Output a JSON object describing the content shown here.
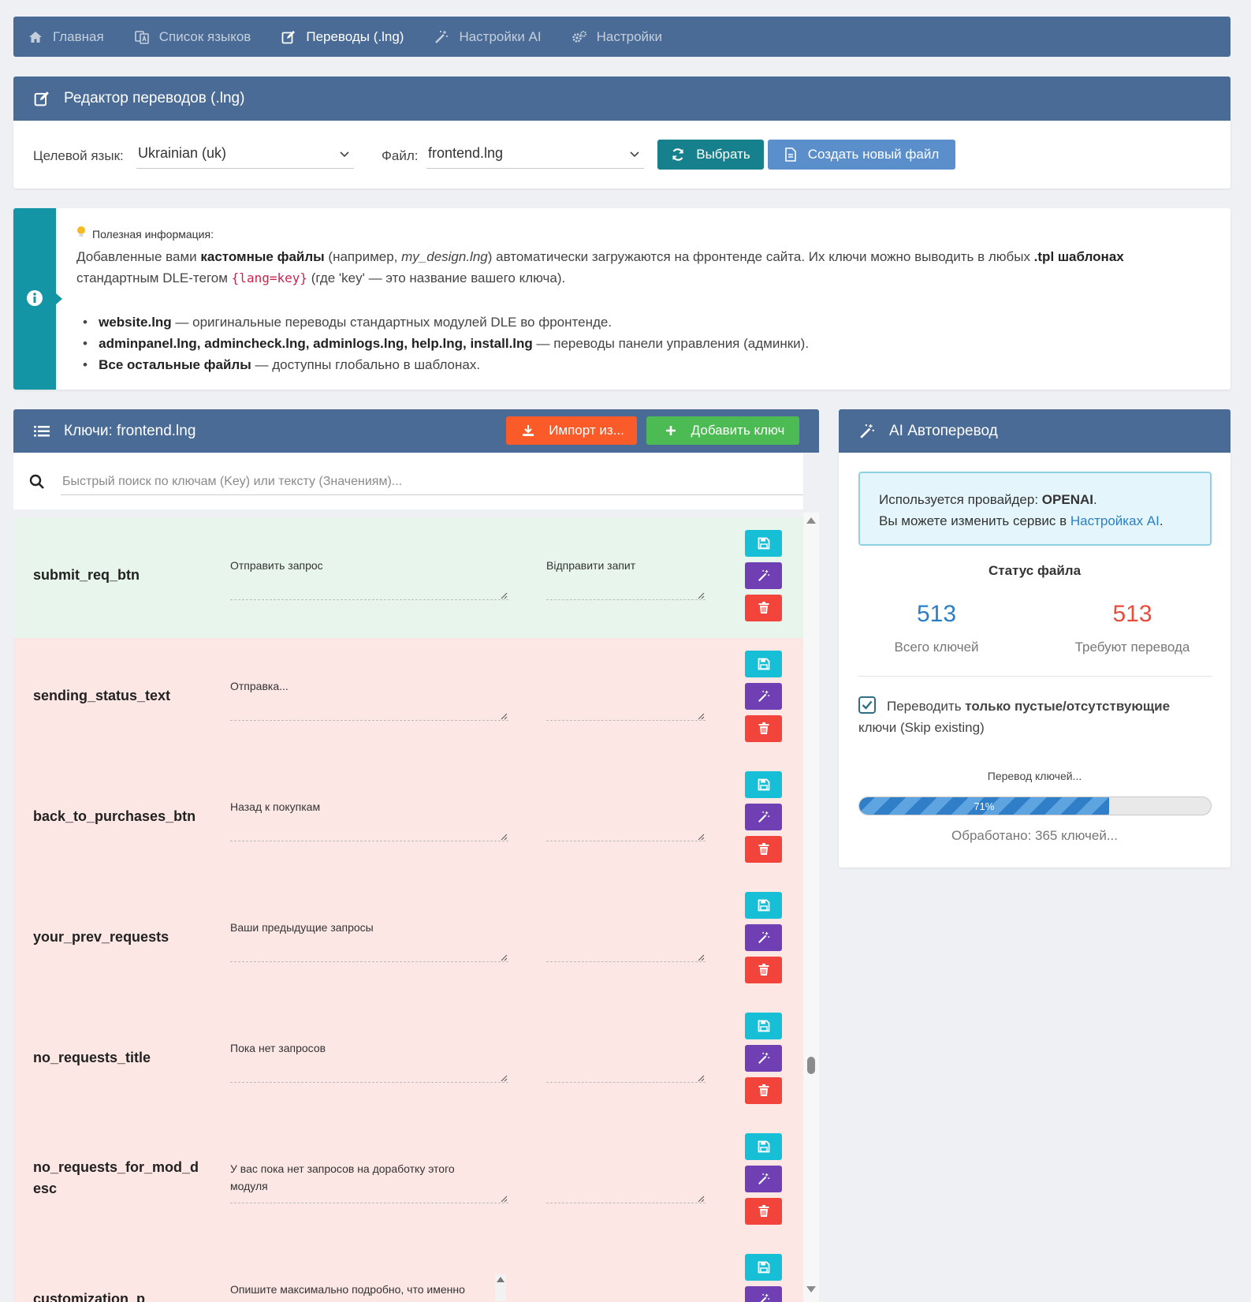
{
  "nav": {
    "items": [
      {
        "label": "Главная",
        "icon": "home-icon"
      },
      {
        "label": "Список языков",
        "icon": "language-icon"
      },
      {
        "label": "Переводы (.lng)",
        "icon": "edit-icon",
        "active": true
      },
      {
        "label": "Настройки AI",
        "icon": "magic-wand-icon"
      },
      {
        "label": "Настройки",
        "icon": "gears-icon"
      }
    ]
  },
  "editor": {
    "title": "Редактор переводов (.lng)",
    "target_lang_label": "Целевой язык:",
    "target_lang_value": "Ukrainian (uk)",
    "file_label": "Файл:",
    "file_value": "frontend.lng",
    "select_button": "Выбрать",
    "new_file_button": "Создать новый файл"
  },
  "info": {
    "title": "Полезная информация:",
    "p_part1": "Добавленные вами ",
    "p_bold1": "кастомные файлы",
    "p_part2": " (например, ",
    "p_italic": "my_design.lng",
    "p_part3": ") автоматически загружаются на фронтенде сайта. Их ключи можно выводить в любых ",
    "p_bold2": ".tpl шаблонах",
    "p_part4": "стандартным DLE-тегом ",
    "p_code": "{lang=key}",
    "p_part5": " (где 'key' — это название вашего ключа).",
    "bullets": [
      {
        "bold": "website.lng",
        "text": " — оригинальные переводы стандартных модулей DLE во фронтенде."
      },
      {
        "bold": "adminpanel.lng, admincheck.lng, adminlogs.lng, help.lng, install.lng",
        "text": " — переводы панели управления (админки)."
      },
      {
        "bold": "Все остальные файлы",
        "text": " — доступны глобально в шаблонах."
      }
    ]
  },
  "keys": {
    "title": "Ключи: frontend.lng",
    "import_button": "Импорт из...",
    "add_button": "Добавить ключ",
    "search_placeholder": "Быстрый поиск по ключам (Key) или тексту (Значениям)...",
    "rows": [
      {
        "key": "submit_req_btn",
        "original": "Отправить запрос",
        "translation": "Відправити запит",
        "status": "translated"
      },
      {
        "key": "sending_status_text",
        "original": "Отправка...",
        "translation": "",
        "status": "missing"
      },
      {
        "key": "back_to_purchases_btn",
        "original": "Назад к покупкам",
        "translation": "",
        "status": "missing"
      },
      {
        "key": "your_prev_requests",
        "original": "Ваши предыдущие запросы",
        "translation": "",
        "status": "missing"
      },
      {
        "key": "no_requests_title",
        "original": "Пока нет запросов",
        "translation": "",
        "status": "missing"
      },
      {
        "key": "no_requests_for_mod_desc",
        "key_line1": "no_requests_for_mod_d",
        "key_line2": "esc",
        "original_line1": "У вас пока нет запросов на доработку этого",
        "original_line2": "модуля",
        "translation": "",
        "status": "missing"
      },
      {
        "key": "customization_p",
        "original": "Опишите максимально подробно, что именно",
        "translation": "",
        "status": "missing"
      }
    ]
  },
  "ai": {
    "title": "AI Автоперевод",
    "provider_prefix": "Используется провайдер: ",
    "provider_name": "OPENAI",
    "provider_suffix": ".",
    "change_text": "Вы можете изменить сервис в ",
    "change_link": "Настройках AI",
    "change_end": ".",
    "status_title": "Статус файла",
    "total_keys": "513",
    "total_label": "Всего ключей",
    "need_translate": "513",
    "need_label": "Требуют перевода",
    "skip_prefix": "Переводить ",
    "skip_bold": "только пустые/отсутствующие",
    "skip_suffix": "ключи (Skip existing)",
    "skip_checked": true,
    "progress_label": "Перевод ключей...",
    "progress_percent": 71,
    "progress_text": "71%",
    "processed_text": "Обработано: 365 ключей..."
  },
  "colors": {
    "header": "#4a6b95",
    "teal": "#17808d",
    "accent_blue": "#2a7fc4",
    "accent_red": "#e84c3d",
    "translated_row": "#e8f5ec",
    "missing_row": "#fce7e5"
  }
}
